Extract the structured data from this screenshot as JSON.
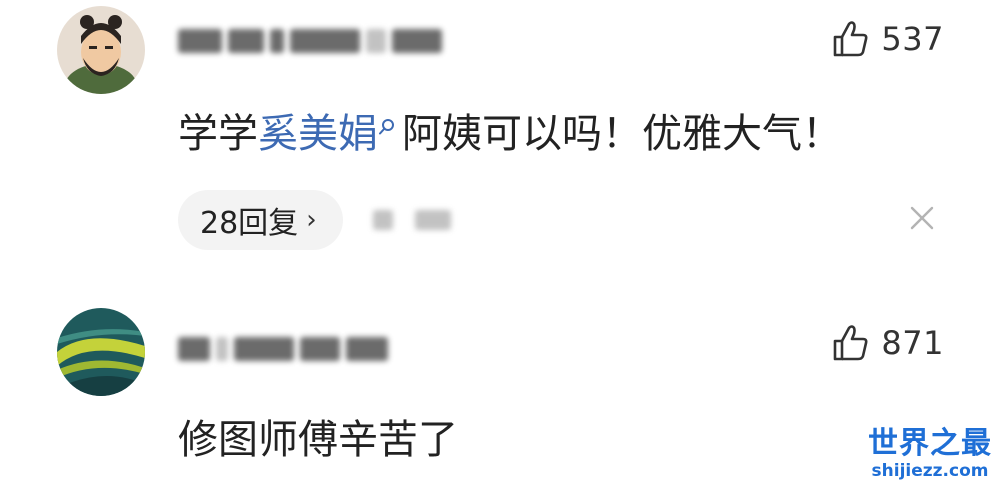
{
  "comments": [
    {
      "username": "",
      "likes": "537",
      "text_before": "学学",
      "link_text": "奚美娟",
      "text_after": "阿姨可以吗！优雅大气！",
      "reply_label": "28回复",
      "reply_chevron": "›"
    },
    {
      "username": "",
      "likes": "871",
      "text": "修图师傅辛苦了"
    }
  ],
  "watermark": {
    "title": "世界之最",
    "url": "shijiezz.com"
  },
  "icons": {
    "like": "thumbs-up-icon",
    "search": "search-icon",
    "close": "close-icon",
    "chevron": "chevron-right-icon"
  },
  "colors": {
    "link": "#3d6ab3",
    "watermark": "#1f6fd6",
    "pill_bg": "#f3f3f3"
  }
}
